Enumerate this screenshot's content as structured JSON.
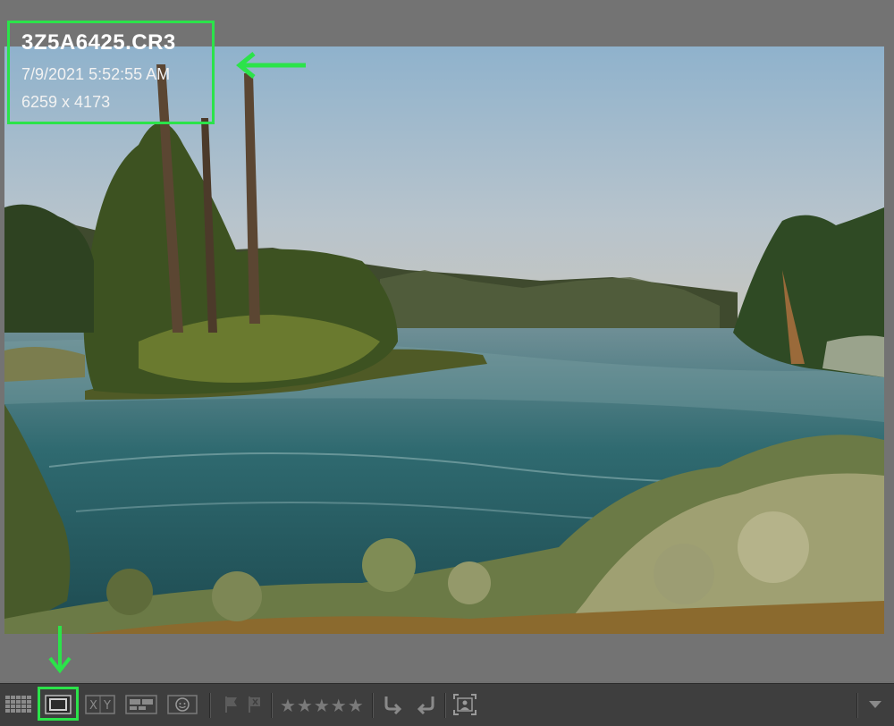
{
  "image_info": {
    "filename": "3Z5A6425.CR3",
    "datetime": "7/9/2021 5:52:55 AM",
    "dimensions": "6259 x 4173"
  },
  "toolbar": {
    "rating_stars": "★★★★★",
    "buttons": [
      "grid-view",
      "loupe-view",
      "compare-view",
      "survey-view",
      "people-view",
      "flag-pick",
      "flag-reject",
      "rotate-left",
      "rotate-right",
      "crop-overlay",
      "toolbar-menu"
    ]
  },
  "colors": {
    "highlight": "#2be34a",
    "toolbar_bg": "#3e3e3e",
    "viewer_bg": "#737373"
  }
}
